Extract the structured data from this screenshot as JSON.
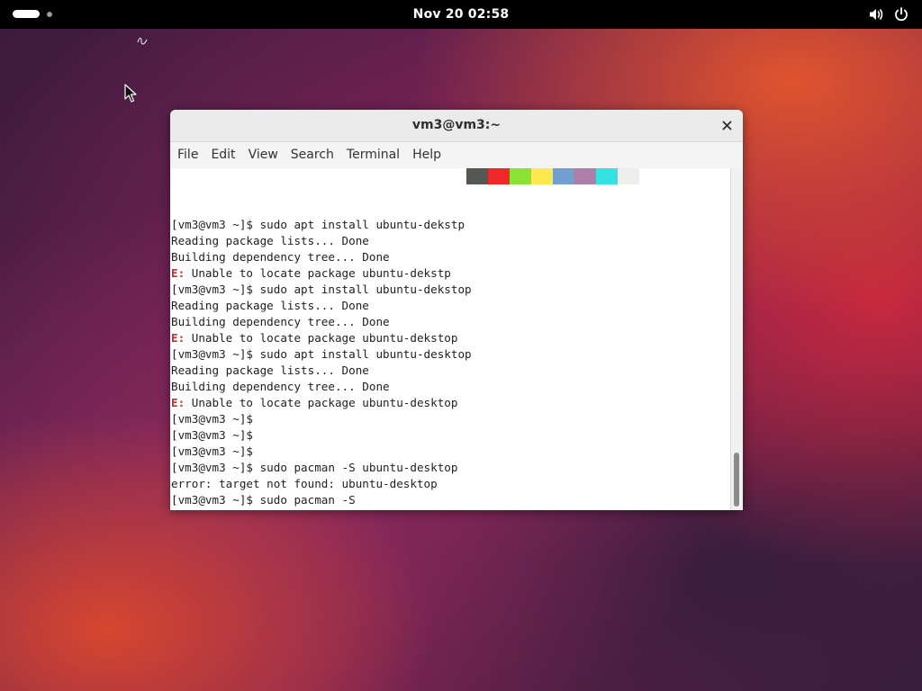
{
  "topbar": {
    "clock": "Nov 20  02:58",
    "volume_icon": "volume-icon",
    "power_icon": "power-icon"
  },
  "window": {
    "title": "vm3@vm3:~",
    "close_icon": "close-icon"
  },
  "menu": {
    "items": [
      "File",
      "Edit",
      "View",
      "Search",
      "Terminal",
      "Help"
    ]
  },
  "palette_colors": [
    "#555753",
    "#ef2929",
    "#8ae234",
    "#fce94f",
    "#729fcf",
    "#ad7fa8",
    "#34e2e2",
    "#eeeeec"
  ],
  "terminal": {
    "lines": [
      {
        "prefix": "",
        "text": "[vm3@vm3 ~]$ sudo apt install ubuntu-dekstp"
      },
      {
        "prefix": "",
        "text": "Reading package lists... Done"
      },
      {
        "prefix": "",
        "text": "Building dependency tree... Done"
      },
      {
        "prefix": "E:",
        "text": " Unable to locate package ubuntu-dekstp"
      },
      {
        "prefix": "",
        "text": "[vm3@vm3 ~]$ sudo apt install ubuntu-dekstop"
      },
      {
        "prefix": "",
        "text": "Reading package lists... Done"
      },
      {
        "prefix": "",
        "text": "Building dependency tree... Done"
      },
      {
        "prefix": "E:",
        "text": " Unable to locate package ubuntu-dekstop"
      },
      {
        "prefix": "",
        "text": "[vm3@vm3 ~]$ sudo apt install ubuntu-desktop"
      },
      {
        "prefix": "",
        "text": "Reading package lists... Done"
      },
      {
        "prefix": "",
        "text": "Building dependency tree... Done"
      },
      {
        "prefix": "E:",
        "text": " Unable to locate package ubuntu-desktop"
      },
      {
        "prefix": "",
        "text": "[vm3@vm3 ~]$"
      },
      {
        "prefix": "",
        "text": "[vm3@vm3 ~]$"
      },
      {
        "prefix": "",
        "text": "[vm3@vm3 ~]$"
      },
      {
        "prefix": "",
        "text": "[vm3@vm3 ~]$ sudo pacman -S ubuntu-desktop"
      },
      {
        "prefix": "",
        "text": "error: target not found: ubuntu-desktop"
      },
      {
        "prefix": "",
        "text": "[vm3@vm3 ~]$ sudo pacman -S"
      }
    ],
    "error_color": "#cc2a2a"
  }
}
